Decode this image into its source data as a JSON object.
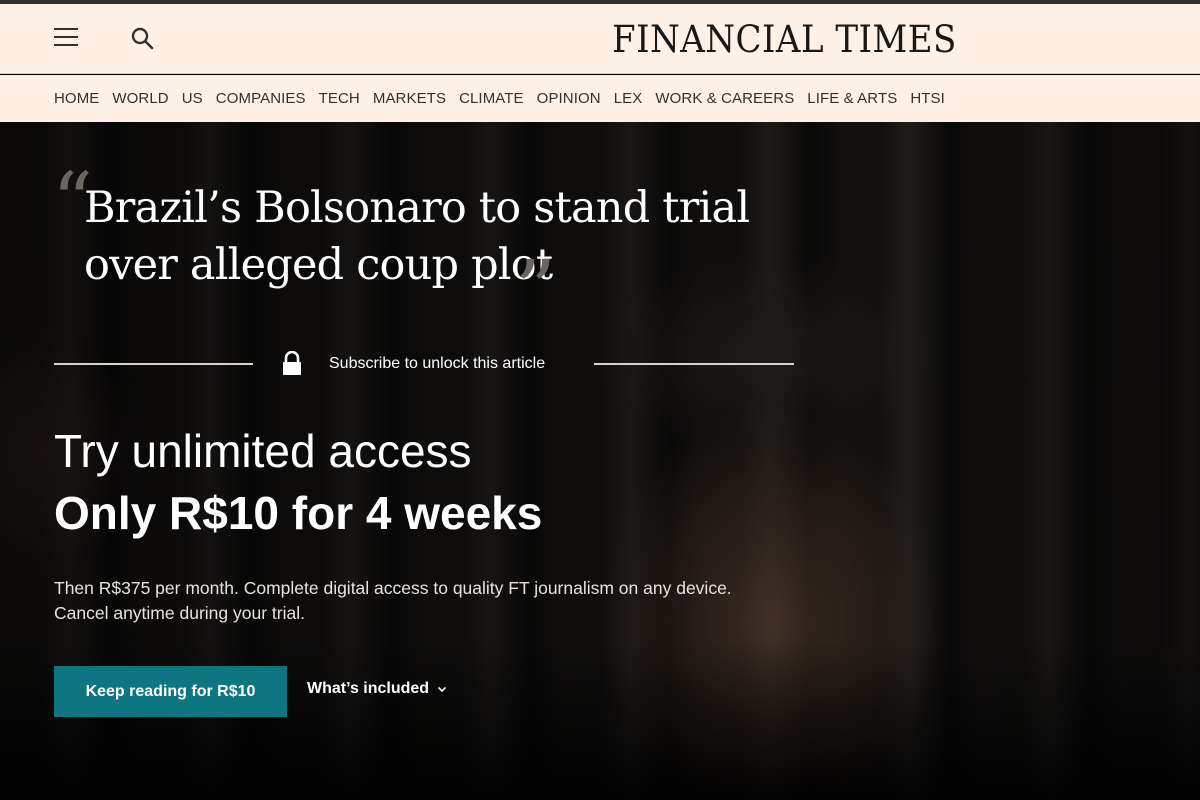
{
  "header": {
    "masthead": "FINANCIAL TIMES"
  },
  "nav": {
    "items": [
      "HOME",
      "WORLD",
      "US",
      "COMPANIES",
      "TECH",
      "MARKETS",
      "CLIMATE",
      "OPINION",
      "LEX",
      "WORK & CAREERS",
      "LIFE & ARTS",
      "HTSI"
    ]
  },
  "article": {
    "headline": "Brazil’s Bolsonaro to stand trial over alleged coup plot",
    "quote_open": "“",
    "quote_close": "”"
  },
  "paywall": {
    "unlock_text": "Subscribe to unlock this article",
    "offer_title": "Try unlimited access",
    "offer_price": "Only R$10 for 4 weeks",
    "offer_description": "Then R$375 per month. Complete digital access to quality FT journalism on any device. Cancel anytime during your trial.",
    "cta_label": "Keep reading for R$10",
    "included_label": "What’s included"
  },
  "colors": {
    "header_bg": "#fff1e5",
    "cta_bg": "#0d7680",
    "text_dark": "#33302e"
  },
  "icons": {
    "menu": "hamburger-menu-icon",
    "search": "search-icon",
    "lock": "lock-icon",
    "chevron": "chevron-down-icon"
  }
}
